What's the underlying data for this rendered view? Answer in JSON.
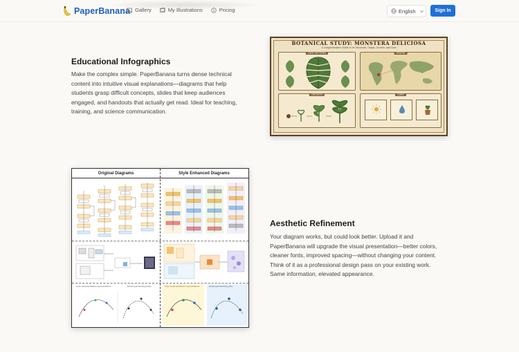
{
  "header": {
    "brand": "PaperBanana",
    "nav": [
      {
        "label": "Gallery",
        "icon": "image-icon"
      },
      {
        "label": "My Illustrations",
        "icon": "gallery-icon"
      },
      {
        "label": "Pricing",
        "icon": "dollar-icon"
      }
    ],
    "language": "English",
    "signin_label": "Sign In"
  },
  "sections": [
    {
      "title": "Educational Infographics",
      "body_lines": [
        "Make the complex simple. PaperBanana turns dense technical",
        "content into intuitive visual explanations—diagrams that help",
        "students grasp difficult concepts, slides that keep audiences",
        "engaged, and handouts that actually get read. Ideal for teaching,",
        "training, and science communication."
      ]
    },
    {
      "title": "Aesthetic Refinement",
      "body_lines": [
        "Your diagram works, but could look better. Upload it and",
        "PaperBanana will upgrade the visual presentation—better colors,",
        "cleaner fonts, improved spacing—without changing your content.",
        "Think of it as a professional design pass on your existing work.",
        "Same information, elevated appearance."
      ]
    }
  ],
  "botanical": {
    "title": "BOTANICAL STUDY: MONSTERA DELICIOSA",
    "subtitle": "A Comprehensive Guide to its Structure, Origin, Growth, and Care",
    "panels": [
      "LEAF PATTERN",
      "ORIGIN",
      "GROWTH",
      "CARE"
    ]
  },
  "diagram": {
    "left_header": "Original Diagrams",
    "right_header": "Style Enhanced Diagrams",
    "row3_left_a": "Learn temporal distance representations",
    "row3_left_b": "Extract goal-reaching policy",
    "row3_right_a": "Learn temporal distance representations",
    "row3_right_b": "Extract goal-reaching policy"
  }
}
